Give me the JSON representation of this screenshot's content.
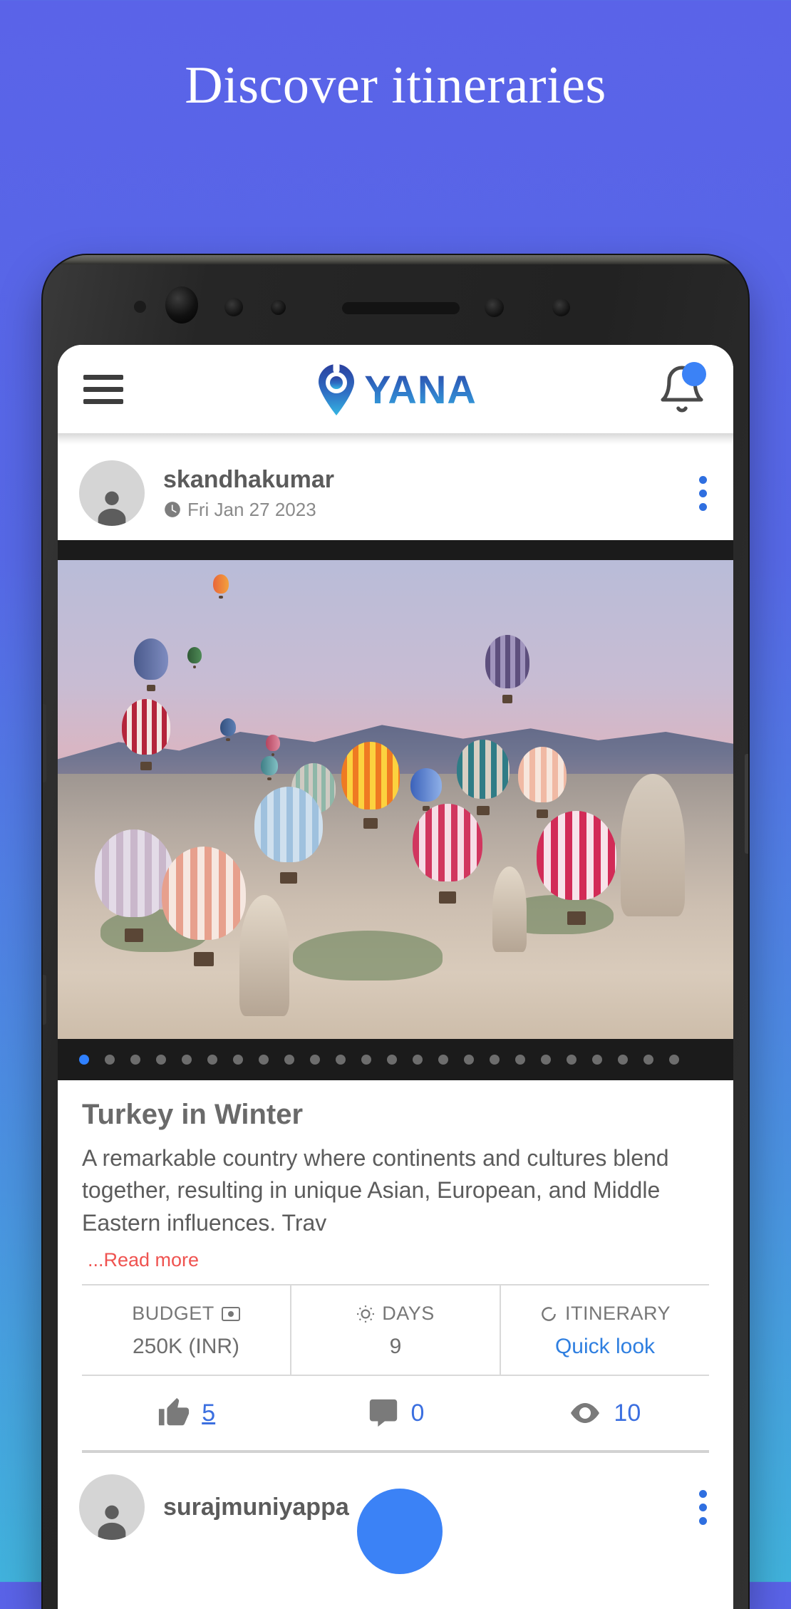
{
  "hero": {
    "headline": "Discover itineraries",
    "background_gradient_from": "#5a63e8",
    "background_gradient_to": "#41b3dd"
  },
  "app": {
    "header": {
      "menu_icon": "hamburger-menu-icon",
      "brand_name": "YANA",
      "brand_mark": "location-pin-icon",
      "notification_icon": "bell-icon",
      "notification_badge": ""
    },
    "accent_colors": {
      "link_blue": "#2f7fe0",
      "badge_blue": "#3b82f6",
      "read_more_red": "#ef5350",
      "brand_blue": "#2a3f9e"
    },
    "feed": [
      {
        "author": "skandhakumar",
        "date": "Fri Jan 27 2023",
        "date_icon": "clock-icon",
        "avatar_icon": "person-avatar-icon",
        "menu_icon": "kebab-menu-icon",
        "media": {
          "alt": "Hot air balloons over Cappadocia at sunrise",
          "total_slides": 24,
          "active_slide": 1
        },
        "title": "Turkey in Winter",
        "description": "A remarkable country where continents and cultures blend together, resulting in unique Asian, European, and Middle Eastern influences. Trav",
        "read_more": "...Read more",
        "stats": [
          {
            "label": "BUDGET",
            "icon": "money-note-icon",
            "value": "250K (INR)",
            "is_link": false
          },
          {
            "label": "DAYS",
            "icon": "sun-icon",
            "value": "9",
            "is_link": false
          },
          {
            "label": "ITINERARY",
            "icon": "circle-outline-icon",
            "value": "Quick look",
            "is_link": true
          }
        ],
        "engagement": [
          {
            "name": "likes",
            "icon": "thumbs-up-icon",
            "count": "5",
            "underline": true
          },
          {
            "name": "comments",
            "icon": "comment-bubble-icon",
            "count": "0",
            "underline": false
          },
          {
            "name": "views",
            "icon": "eye-icon",
            "count": "10",
            "underline": false
          }
        ]
      },
      {
        "author": "surajmuniyappa",
        "avatar_icon": "person-avatar-icon",
        "menu_icon": "kebab-menu-icon"
      }
    ]
  }
}
